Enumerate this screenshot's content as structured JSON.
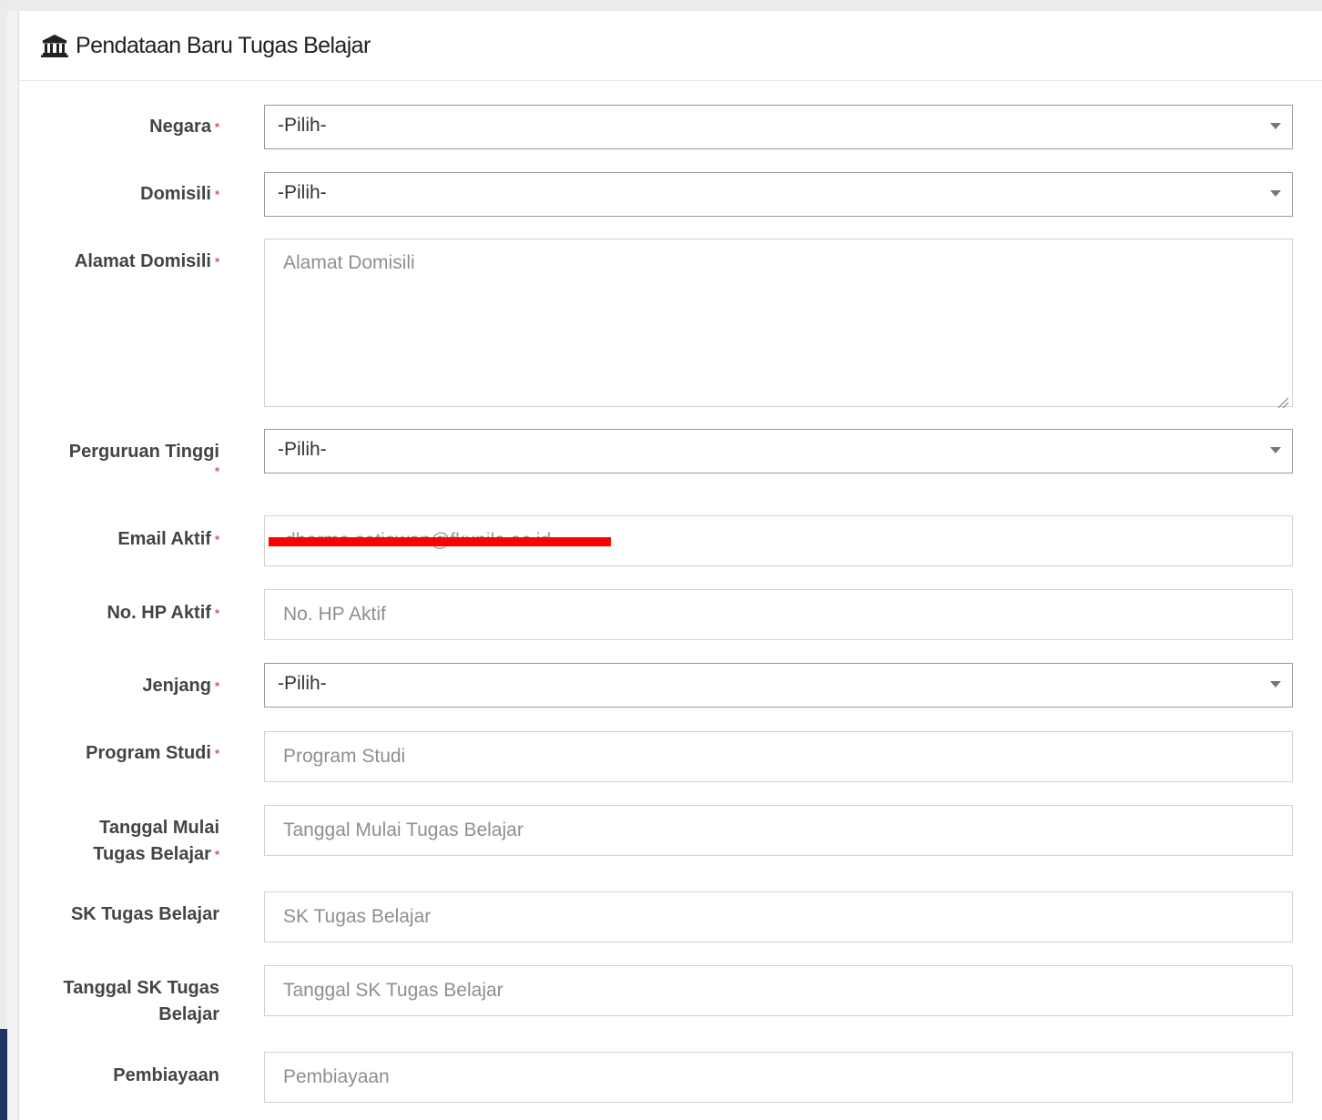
{
  "panel": {
    "title": "Pendataan Baru Tugas Belajar",
    "icon": "institution-icon"
  },
  "required_mark": "*",
  "fields": {
    "negara": {
      "label": "Negara",
      "value": "-Pilih-"
    },
    "domisili": {
      "label": "Domisili",
      "value": "-Pilih-"
    },
    "alamat_domisili": {
      "label": "Alamat Domisili",
      "placeholder": "Alamat Domisili"
    },
    "perguruan_tinggi": {
      "label": "Perguruan Tinggi",
      "value": "-Pilih-"
    },
    "email_aktif": {
      "label": "Email Aktif",
      "value": "dharma.setiawan@fkunila.ac.id"
    },
    "no_hp_aktif": {
      "label": "No. HP Aktif",
      "placeholder": "No. HP Aktif"
    },
    "jenjang": {
      "label": "Jenjang",
      "value": "-Pilih-"
    },
    "program_studi": {
      "label": "Program Studi",
      "placeholder": "Program Studi"
    },
    "tanggal_mulai": {
      "label_line1": "Tanggal Mulai",
      "label_line2": "Tugas Belajar",
      "placeholder": "Tanggal Mulai Tugas Belajar"
    },
    "sk_tugas_belajar": {
      "label": "SK Tugas Belajar",
      "placeholder": "SK Tugas Belajar"
    },
    "tanggal_sk": {
      "label_line1": "Tanggal SK Tugas",
      "label_line2": "Belajar",
      "placeholder": "Tanggal SK Tugas Belajar"
    },
    "pembiayaan": {
      "label": "Pembiayaan",
      "placeholder": "Pembiayaan"
    }
  },
  "colors": {
    "required": "#d9534f",
    "redaction": "#ff0000"
  }
}
